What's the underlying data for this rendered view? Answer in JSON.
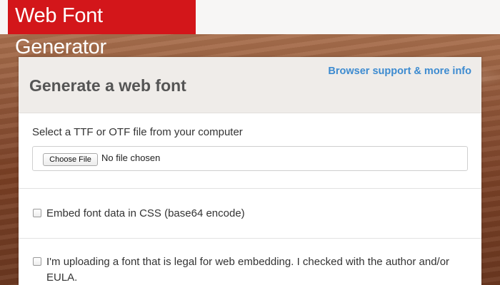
{
  "header": {
    "logo_text": "Web Font Generator"
  },
  "card": {
    "title": "Generate a web font",
    "info_link": "Browser support & more info",
    "file": {
      "label": "Select a TTF or OTF file from your computer",
      "button_label": "Choose File",
      "status": "No file chosen"
    },
    "embed_option": {
      "label": "Embed font data in CSS (base64 encode)",
      "checked": false
    },
    "legal_option": {
      "label": "I'm uploading a font that is legal for web embedding. I checked with the author and/or EULA.",
      "checked": false
    }
  },
  "colors": {
    "logo_bg": "#d3161a",
    "link": "#3d8bd0",
    "header_bg": "#efece9"
  }
}
